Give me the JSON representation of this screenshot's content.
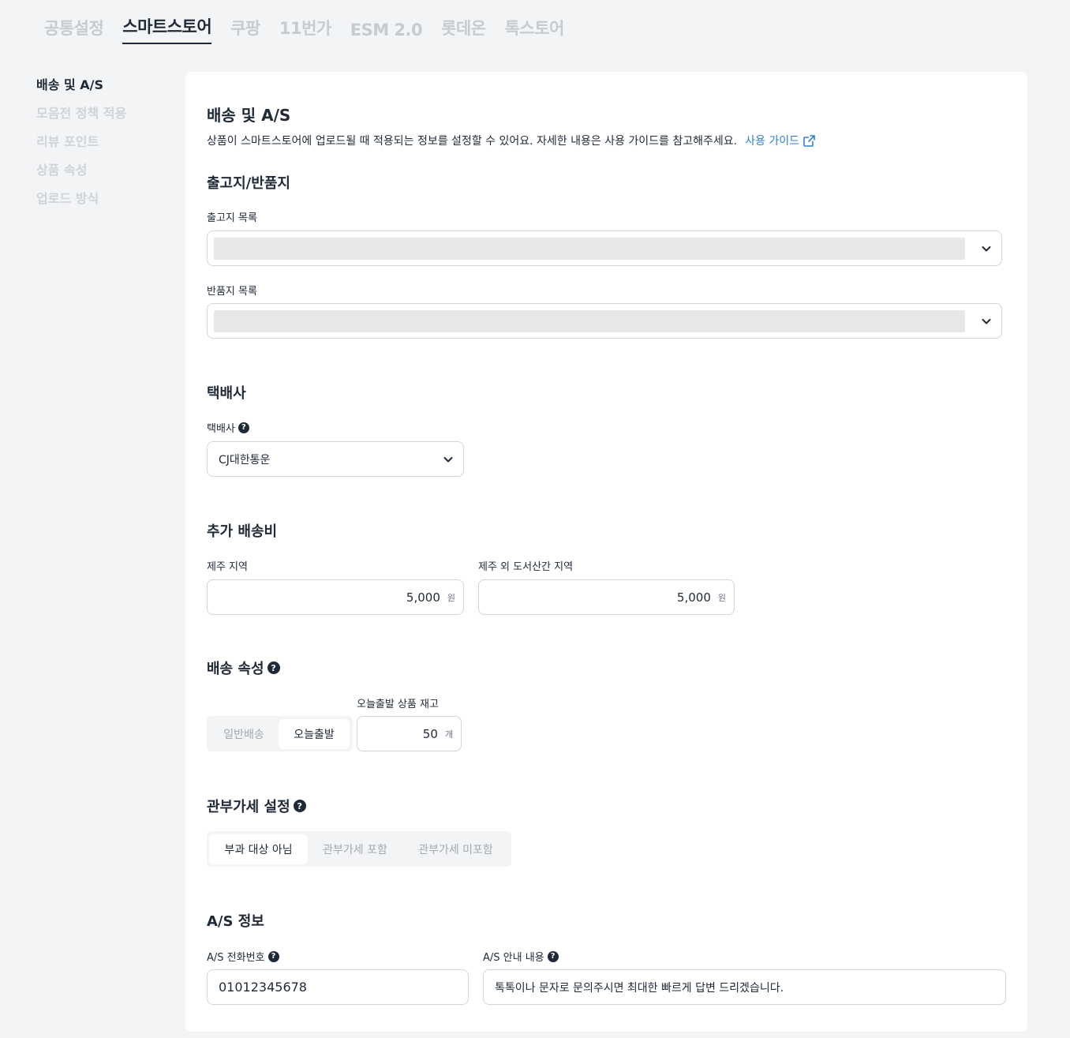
{
  "top_tabs": [
    "공통설정",
    "스마트스토어",
    "쿠팡",
    "11번가",
    "ESM 2.0",
    "롯데온",
    "톡스토어"
  ],
  "side_nav": [
    "배송 및 A/S",
    "모음전 정책 적용",
    "리뷰 포인트",
    "상품 속성",
    "업로드 방식"
  ],
  "main": {
    "title": "배송 및 A/S",
    "description": "상품이 스마트스토어에 업로드될 때 적용되는 정보를 설정할 수 있어요. 자세한 내용은 사용 가이드를 참고해주세요.",
    "guide_link": "사용 가이드"
  },
  "warehouse": {
    "heading": "출고지/반품지",
    "release_label": "출고지 목록",
    "return_label": "반품지 목록"
  },
  "courier": {
    "heading": "택배사",
    "label": "택배사",
    "value": "CJ대한통운"
  },
  "extra_fee": {
    "heading": "추가 배송비",
    "jeju_label": "제주 지역",
    "jeju_value": "5,000",
    "island_label": "제주 외 도서산간 지역",
    "island_value": "5,000",
    "unit": "원"
  },
  "shipping_attr": {
    "heading": "배송 속성",
    "options": [
      "일반배송",
      "오늘출발"
    ],
    "selected": "오늘출발",
    "stock_label": "오늘출발 상품 재고",
    "stock_value": "50",
    "stock_unit": "개"
  },
  "customs": {
    "heading": "관부가세 설정",
    "options": [
      "부과 대상 아님",
      "관부가세 포함",
      "관부가세 미포함"
    ],
    "selected": "부과 대상 아님"
  },
  "as_info": {
    "heading": "A/S 정보",
    "phone_label": "A/S 전화번호",
    "phone_value": "01012345678",
    "guide_label": "A/S 안내 내용",
    "guide_value": "톡톡이나 문자로 문의주시면 최대한 빠르게 답변 드리겠습니다."
  },
  "icons": {
    "help": "question-circle-icon",
    "chevron": "chevron-down-icon",
    "external": "external-link-icon"
  },
  "colors": {
    "link": "#2f80d1",
    "text": "#1f2937",
    "background": "#f3f4f6"
  }
}
